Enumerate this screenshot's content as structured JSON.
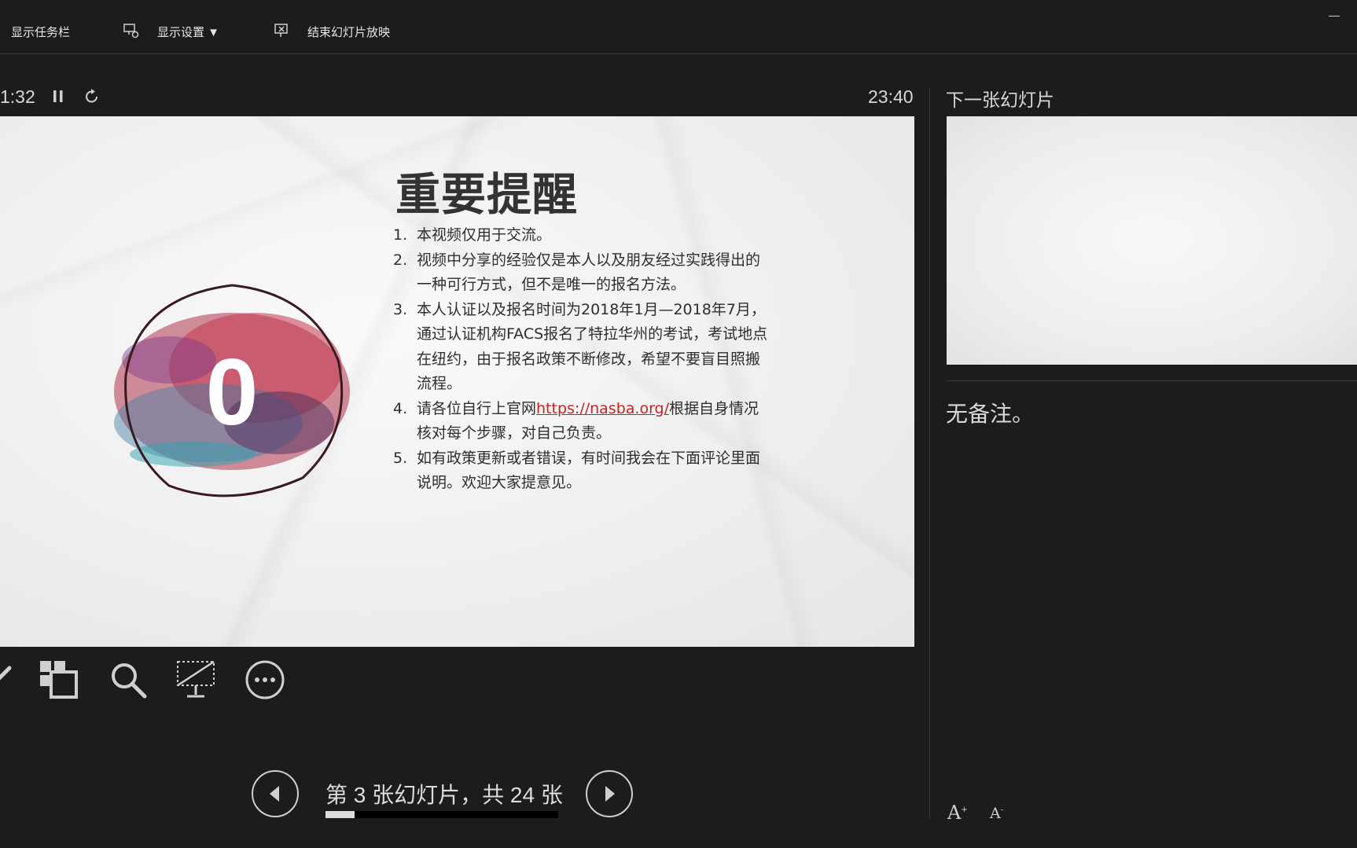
{
  "toolbar": {
    "show_taskbar": "显示任务栏",
    "display_settings": "显示设置 ▼",
    "end_slideshow": "结束幻灯片放映"
  },
  "presenter": {
    "elapsed_time": "1:32",
    "clock": "23:40",
    "next_slide_label": "下一张幻灯片",
    "notes_text": "无备注。"
  },
  "slide": {
    "title": "重要提醒",
    "emblem_label": "0",
    "items": [
      {
        "num": "1.",
        "text": "本视频仅用于交流。"
      },
      {
        "num": "2.",
        "text": "视频中分享的经验仅是本人以及朋友经过实践得出的一种可行方式，但不是唯一的报名方法。"
      },
      {
        "num": "3.",
        "text": "本人认证以及报名时间为2018年1月—2018年7月，通过认证机构FACS报名了特拉华州的考试，考试地点在纽约，由于报名政策不断修改，希望不要盲目照搬流程。"
      },
      {
        "num": "4.",
        "text_before": "请各位自行上官网",
        "link": "https://nasba.org/",
        "text_after": "根据自身情况核对每个步骤，对自己负责。"
      },
      {
        "num": "5.",
        "text": "如有政策更新或者错误，有时间我会在下面评论里面说明。欢迎大家提意见。"
      }
    ]
  },
  "navigation": {
    "counter": "第 3 张幻灯片，共 24 张",
    "current": 3,
    "total": 24,
    "progress_fraction": 0.125
  },
  "icons": {
    "pen": "pen-icon",
    "grid": "see-all-slides-icon",
    "zoom": "zoom-icon",
    "screen": "black-screen-icon",
    "more": "more-options-icon"
  },
  "colors": {
    "background": "#1c1c1c",
    "link": "#c0261f"
  }
}
